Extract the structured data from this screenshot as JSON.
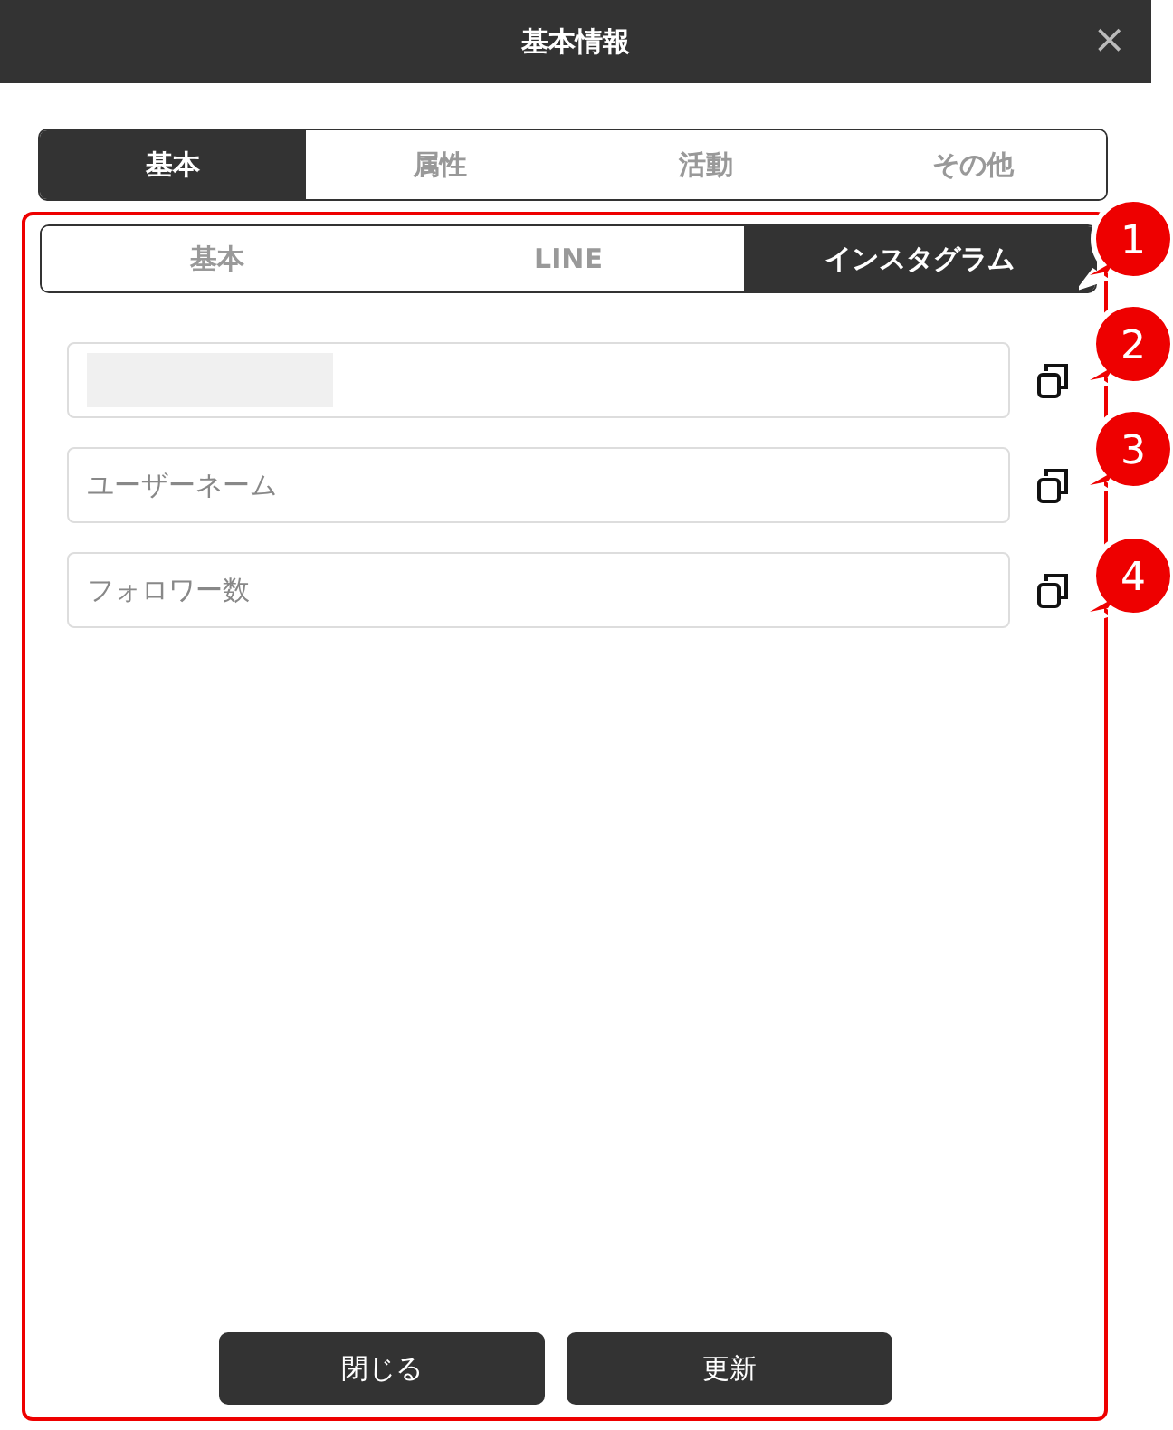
{
  "window": {
    "title": "基本情報",
    "close": "×"
  },
  "tabs": [
    {
      "label": "基本",
      "selected": true
    },
    {
      "label": "属性",
      "selected": false
    },
    {
      "label": "活動",
      "selected": false
    },
    {
      "label": "その他",
      "selected": false
    }
  ],
  "sub_tabs": [
    {
      "label": "基本",
      "selected": false
    },
    {
      "label": "LINE",
      "selected": false
    },
    {
      "label": "インスタグラム",
      "selected": true
    }
  ],
  "fields": [
    {
      "kind": "redacted"
    },
    {
      "kind": "text",
      "placeholder": "ユーザーネーム"
    },
    {
      "kind": "text",
      "placeholder": "フォロワー数"
    }
  ],
  "callouts": [
    "1",
    "2",
    "3",
    "4"
  ],
  "buttons": [
    "閉じる",
    "更新"
  ]
}
